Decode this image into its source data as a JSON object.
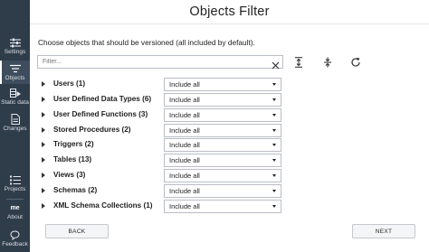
{
  "sidebar": {
    "settings": "Settings",
    "objects": "Objects",
    "static_data": "Static data",
    "changes": "Changes",
    "projects": "Projects",
    "about_badge": "me",
    "about": "About",
    "feedback": "Feedback"
  },
  "header": {
    "title": "Objects Filter"
  },
  "description": "Choose objects that should be versioned (all included by default).",
  "filter": {
    "placeholder": "Filter...",
    "value": ""
  },
  "rows": [
    {
      "name": "Users (1)",
      "option": "Include all"
    },
    {
      "name": "User Defined Data Types (6)",
      "option": "Include all"
    },
    {
      "name": "User Defined Functions (3)",
      "option": "Include all"
    },
    {
      "name": "Stored Procedures (2)",
      "option": "Include all"
    },
    {
      "name": "Triggers (2)",
      "option": "Include all"
    },
    {
      "name": "Tables (13)",
      "option": "Include all"
    },
    {
      "name": "Views (3)",
      "option": "Include all"
    },
    {
      "name": "Schemas (2)",
      "option": "Include all"
    },
    {
      "name": "XML Schema Collections (1)",
      "option": "Include all"
    }
  ],
  "footer": {
    "back": "BACK",
    "next": "NEXT"
  },
  "colors": {
    "sidebar_bg": "#2f3c4a",
    "sidebar_active": "#3e4d5d"
  }
}
